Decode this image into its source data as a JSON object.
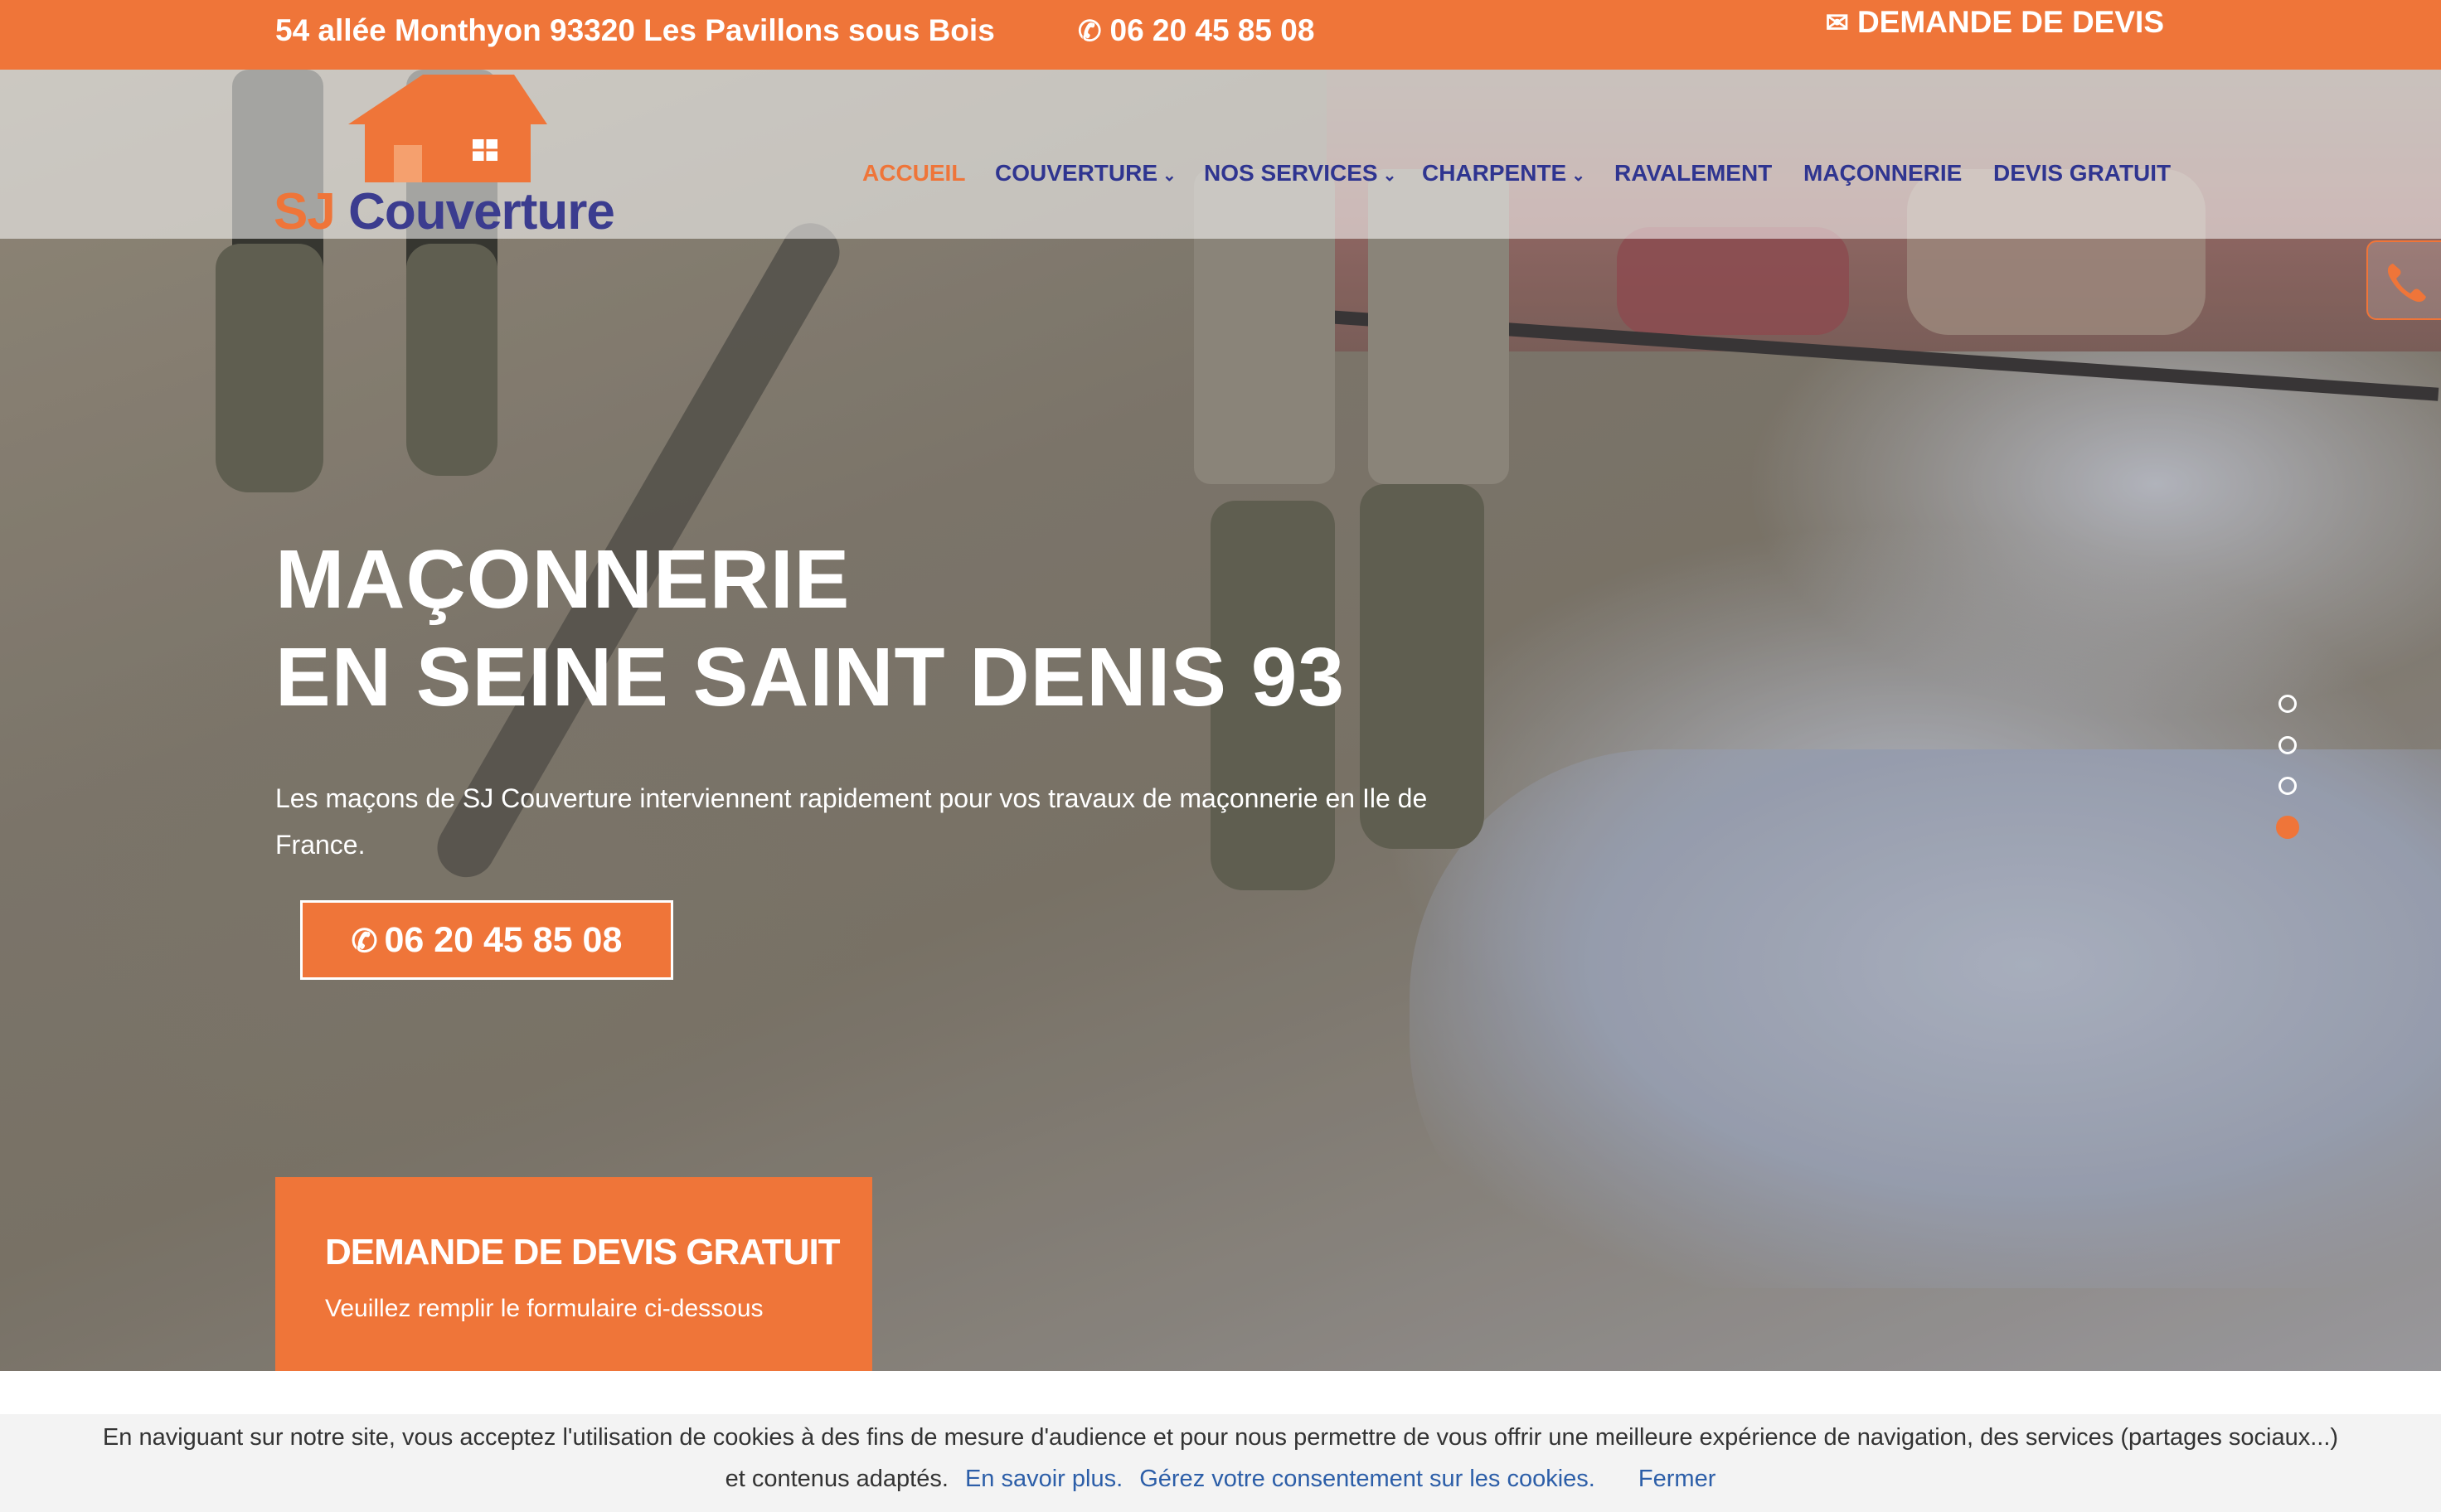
{
  "colors": {
    "accent": "#ef7539",
    "nav": "#2f3590",
    "brand_blue": "#3b3c8f",
    "link": "#2c5ea8"
  },
  "topbar": {
    "address": "54 allée Monthyon 93320 Les Pavillons sous Bois",
    "phone_icon": "phone-icon",
    "phone": "06 20 45 85 08",
    "devis_icon": "envelope-icon",
    "devis": "DEMANDE DE DEVIS"
  },
  "logo": {
    "sj": "SJ",
    "name": "Couverture"
  },
  "nav": {
    "items": [
      {
        "label": "ACCUEIL",
        "active": true,
        "dropdown": false
      },
      {
        "label": "COUVERTURE",
        "active": false,
        "dropdown": true
      },
      {
        "label": "NOS SERVICES",
        "active": false,
        "dropdown": true
      },
      {
        "label": "CHARPENTE",
        "active": false,
        "dropdown": true
      },
      {
        "label": "RAVALEMENT",
        "active": false,
        "dropdown": false
      },
      {
        "label": "MAÇONNERIE",
        "active": false,
        "dropdown": false
      },
      {
        "label": "DEVIS GRATUIT",
        "active": false,
        "dropdown": false
      }
    ],
    "chevron": "⌄"
  },
  "hero": {
    "title_line1": "MAÇONNERIE",
    "title_line2": "EN SEINE SAINT DENIS 93",
    "subtitle": "Les maçons de SJ Couverture interviennent rapidement pour vos travaux de maçonnerie en Ile de France.",
    "button_phone": "06 20 45 85 08",
    "slides_total": 4,
    "slide_active": 4
  },
  "quote": {
    "title": "DEMANDE DE DEVIS GRATUIT",
    "subtitle": "Veuillez remplir le formulaire ci-dessous"
  },
  "cookie": {
    "line1": "En naviguant sur notre site, vous acceptez l'utilisation de cookies à des fins de mesure d'audience et pour nous permettre de vous offrir une meilleure expérience de navigation, des services (partages sociaux...)",
    "line2": "et contenus adaptés.",
    "learn_more": "En savoir plus.",
    "manage": "Gérez votre consentement sur les cookies.",
    "close": "Fermer"
  }
}
